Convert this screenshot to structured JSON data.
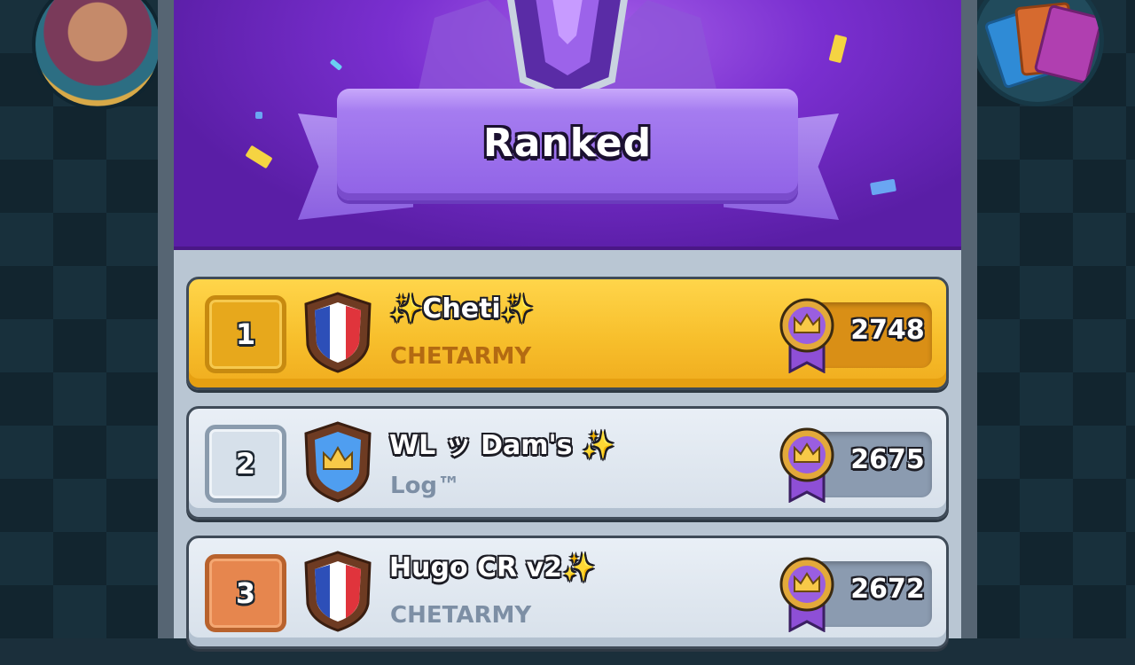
{
  "header": {
    "title": "Ranked"
  },
  "colors": {
    "header_purple": "#7a2fd0",
    "gold_row": "#f7bf2c",
    "silver_row": "#d7e0ea",
    "rank_gold": "#e7a81c",
    "rank_silver": "#d6e0ea",
    "rank_bronze": "#e6864e",
    "medal_purple": "#8e4fd6"
  },
  "leaderboard": {
    "rows": [
      {
        "rank": "1",
        "name": "✨Cheti✨",
        "clan": "CHETARMY",
        "trophies": "2748",
        "badge": "france-flag-shield-icon",
        "style": "gold"
      },
      {
        "rank": "2",
        "name": "WL ッ Dam's ✨",
        "clan": "Log™",
        "trophies": "2675",
        "badge": "crown-shield-icon",
        "style": "silver"
      },
      {
        "rank": "3",
        "name": "Hugo CR v2✨",
        "clan": "CHETARMY",
        "trophies": "2672",
        "badge": "france-flag-shield-icon",
        "style": "silver"
      }
    ]
  }
}
